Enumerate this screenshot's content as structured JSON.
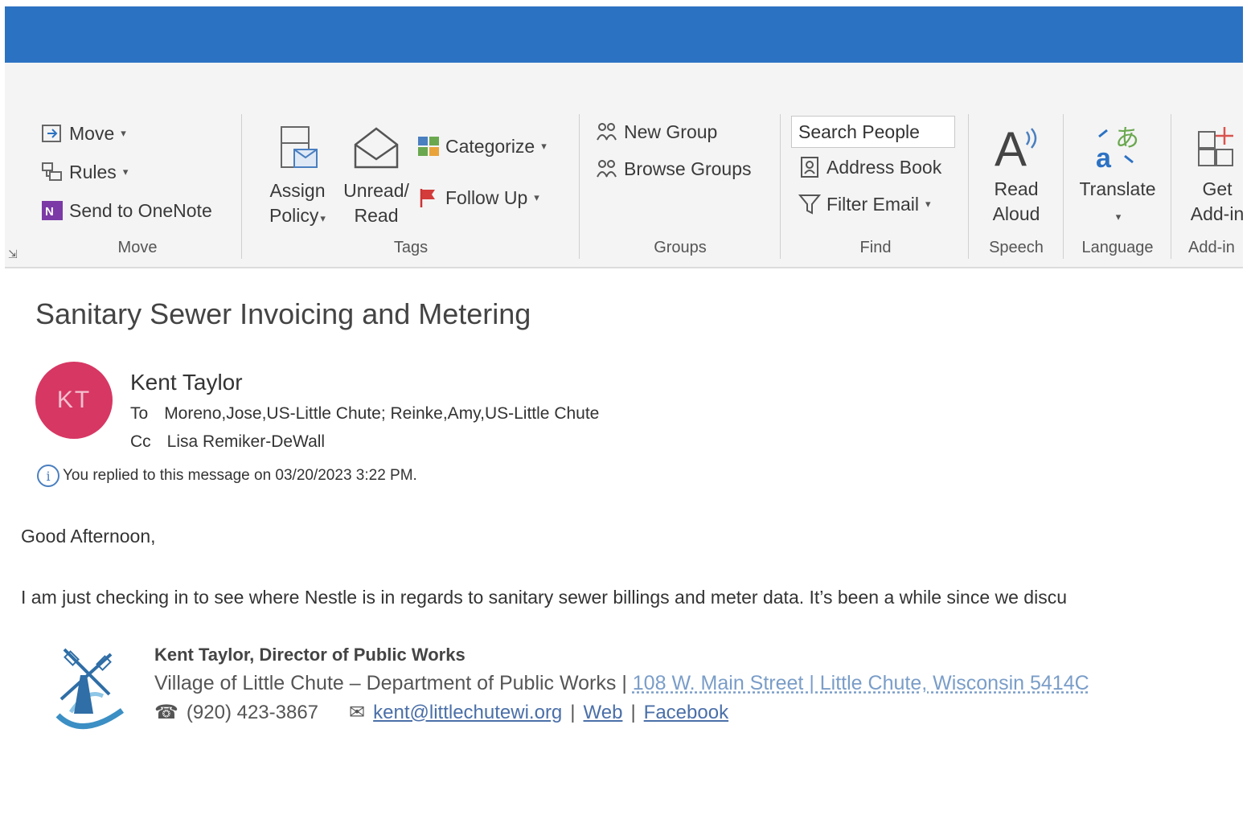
{
  "ribbon": {
    "move_group": {
      "label": "Move",
      "move": "Move",
      "rules": "Rules",
      "send_to_onenote": "Send to OneNote"
    },
    "tags_group": {
      "label": "Tags",
      "assign_policy_line1": "Assign",
      "assign_policy_line2": "Policy",
      "unread_read_line1": "Unread/",
      "unread_read_line2": "Read",
      "categorize": "Categorize",
      "follow_up": "Follow Up"
    },
    "groups_group": {
      "label": "Groups",
      "new_group": "New Group",
      "browse_groups": "Browse Groups"
    },
    "find_group": {
      "label": "Find",
      "search_people": "Search People",
      "address_book": "Address Book",
      "filter_email": "Filter Email"
    },
    "speech_group": {
      "label": "Speech",
      "read_aloud_line1": "Read",
      "read_aloud_line2": "Aloud"
    },
    "language_group": {
      "label": "Language",
      "translate": "Translate"
    },
    "addin_group": {
      "label": "Add-in",
      "get_addins_line1": "Get",
      "get_addins_line2": "Add-in"
    }
  },
  "message": {
    "subject": "Sanitary Sewer Invoicing and Metering",
    "avatar_initials": "KT",
    "sender": "Kent Taylor",
    "to_label": "To",
    "to_value": "Moreno,Jose,US-Little Chute; Reinke,Amy,US-Little Chute",
    "cc_label": "Cc",
    "cc_value": "Lisa Remiker-DeWall",
    "info_text": "You replied to this message on 03/20/2023 3:22 PM.",
    "greeting": "Good Afternoon,",
    "body": "I am just checking in to see where Nestle is in regards to sanitary sewer billings and meter data. It’s been a while since we discu"
  },
  "signature": {
    "name_title": "Kent Taylor, Director of Public Works",
    "org": "Village of Little Chute – Department of Public Works",
    "sep1": "|",
    "address": "108 W. Main Street  |  Little Chute, Wisconsin 5414C",
    "phone": "(920) 423-3867",
    "email": "kent@littlechutewi.org",
    "sep2": "|",
    "web": "Web",
    "sep3": "|",
    "facebook": "Facebook"
  },
  "colors": {
    "titlebar": "#2c72c3",
    "avatar": "#d73763",
    "link": "#4a6fa8"
  }
}
